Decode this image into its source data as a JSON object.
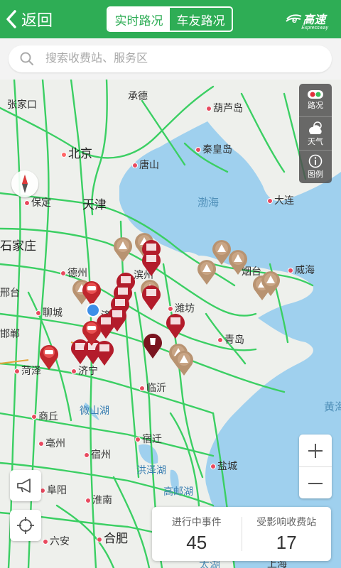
{
  "header": {
    "back_label": "返回",
    "tabs": [
      {
        "label": "实时路况",
        "active": true
      },
      {
        "label": "车友路况",
        "active": false
      }
    ],
    "logo_main": "高速",
    "logo_sub": "Expressway"
  },
  "search": {
    "placeholder": "搜索收费站、服务区"
  },
  "map": {
    "cities": {
      "chengde": "承德",
      "zhangjiakou": "张家口",
      "beijing": "北京",
      "tangshan": "唐山",
      "qinhuangdao": "秦皇岛",
      "huludao": "葫芦岛",
      "tianjin": "天津",
      "baoding": "保定",
      "shijiazhuang": "石家庄",
      "dalian": "大连",
      "weihai": "威海",
      "yantai": "烟台",
      "dezhou": "德州",
      "binzhou": "滨州",
      "liaocheng": "聊城",
      "weifang": "潍坊",
      "qingdao": "青岛",
      "heze": "菏泽",
      "jining": "济宁",
      "linyi": "临沂",
      "shangqiu": "商丘",
      "suqian": "宿迁",
      "bozhou": "亳州",
      "suzhou": "宿州",
      "yancheng": "盐城",
      "fuyang": "阜阳",
      "huainan": "淮南",
      "hefei": "合肥",
      "liuan": "六安",
      "xingtai": "邢台",
      "handan": "邯郸",
      "jinan": "济南",
      "shanghai": "上海"
    },
    "seas": {
      "bohai": "渤海",
      "huanghai": "黄海",
      "taihu": "太湖"
    },
    "lakes": {
      "weishan": "微山湖",
      "hongze": "洪泽湖",
      "gaoyou": "高邮湖"
    },
    "controls": {
      "traffic": "路况",
      "weather": "天气",
      "legend": "图例"
    },
    "colors": {
      "road": "#3bcf63",
      "sea": "#9fd0ee",
      "accent": "#2ead55",
      "incident": "#b31c2b",
      "construction": "#b89371"
    }
  },
  "stats": {
    "ongoing_label": "进行中事件",
    "ongoing_value": "45",
    "toll_label": "受影响收费站",
    "toll_value": "17"
  }
}
